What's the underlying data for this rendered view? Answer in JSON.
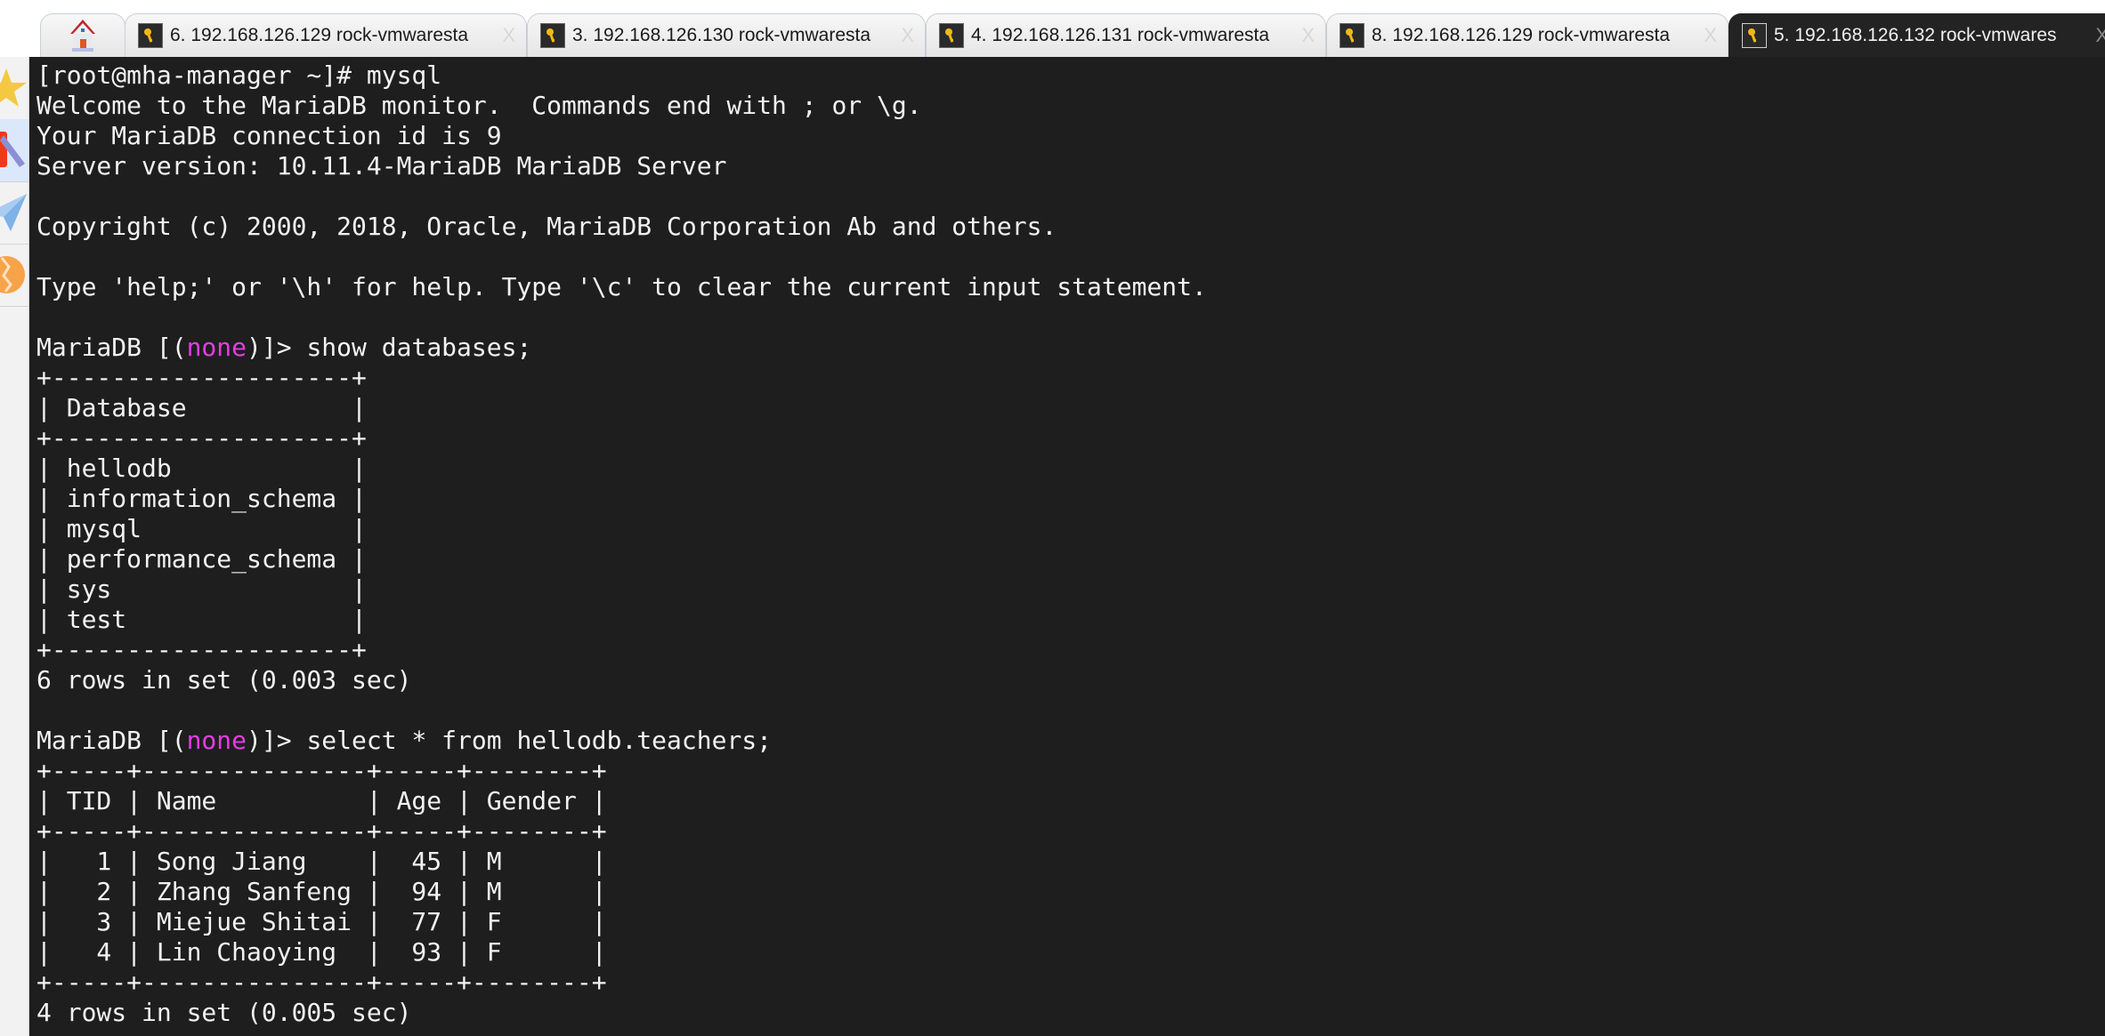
{
  "tabs": [
    {
      "icon": "home-icon",
      "label": ""
    },
    {
      "icon": "key-icon",
      "label": "6. 192.168.126.129 rock-vmwaresta",
      "active": false
    },
    {
      "icon": "key-icon",
      "label": "3. 192.168.126.130 rock-vmwaresta",
      "active": false
    },
    {
      "icon": "key-icon",
      "label": "4. 192.168.126.131 rock-vmwaresta",
      "active": false
    },
    {
      "icon": "key-icon",
      "label": "8. 192.168.126.129 rock-vmwaresta",
      "active": false
    },
    {
      "icon": "key-icon",
      "label": "5. 192.168.126.132 rock-vmwares",
      "active": true
    }
  ],
  "tab_close_glyph": "X",
  "sidebar": {
    "items": [
      {
        "icon": "star-icon"
      },
      {
        "icon": "bookmark-tool-icon"
      },
      {
        "icon": "paper-plane-icon"
      },
      {
        "icon": "globe-icon"
      }
    ]
  },
  "colors": {
    "terminal_bg": "#1e1e1e",
    "terminal_fg": "#f2f2f2",
    "highlight": "#e23ee2",
    "active_tab": "#232323"
  },
  "terminal": {
    "lines": [
      {
        "text": "[root@mha-manager ~]# mysql"
      },
      {
        "text": "Welcome to the MariaDB monitor.  Commands end with ; or \\g."
      },
      {
        "text": "Your MariaDB connection id is 9"
      },
      {
        "text": "Server version: 10.11.4-MariaDB MariaDB Server"
      },
      {
        "text": ""
      },
      {
        "text": "Copyright (c) 2000, 2018, Oracle, MariaDB Corporation Ab and others."
      },
      {
        "text": ""
      },
      {
        "text": "Type 'help;' or '\\h' for help. Type '\\c' to clear the current input statement."
      },
      {
        "text": ""
      },
      {
        "prompt_pre": "MariaDB [(",
        "prompt_db": "none",
        "prompt_post": ")]> ",
        "command": "show databases;"
      },
      {
        "text": "+--------------------+"
      },
      {
        "text": "| Database           |"
      },
      {
        "text": "+--------------------+"
      },
      {
        "text": "| hellodb            |"
      },
      {
        "text": "| information_schema |"
      },
      {
        "text": "| mysql              |"
      },
      {
        "text": "| performance_schema |"
      },
      {
        "text": "| sys                |"
      },
      {
        "text": "| test               |"
      },
      {
        "text": "+--------------------+"
      },
      {
        "text": "6 rows in set (0.003 sec)"
      },
      {
        "text": ""
      },
      {
        "prompt_pre": "MariaDB [(",
        "prompt_db": "none",
        "prompt_post": ")]> ",
        "command": "select * from hellodb.teachers;"
      },
      {
        "text": "+-----+---------------+-----+--------+"
      },
      {
        "text": "| TID | Name          | Age | Gender |"
      },
      {
        "text": "+-----+---------------+-----+--------+"
      },
      {
        "text": "|   1 | Song Jiang    |  45 | M      |"
      },
      {
        "text": "|   2 | Zhang Sanfeng |  94 | M      |"
      },
      {
        "text": "|   3 | Miejue Shitai |  77 | F      |"
      },
      {
        "text": "|   4 | Lin Chaoying  |  93 | F      |"
      },
      {
        "text": "+-----+---------------+-----+--------+"
      },
      {
        "text": "4 rows in set (0.005 sec)"
      }
    ]
  },
  "query_results": {
    "databases": {
      "columns": [
        "Database"
      ],
      "rows": [
        [
          "hellodb"
        ],
        [
          "information_schema"
        ],
        [
          "mysql"
        ],
        [
          "performance_schema"
        ],
        [
          "sys"
        ],
        [
          "test"
        ]
      ],
      "summary": "6 rows in set (0.003 sec)"
    },
    "teachers": {
      "columns": [
        "TID",
        "Name",
        "Age",
        "Gender"
      ],
      "rows": [
        [
          "1",
          "Song Jiang",
          "45",
          "M"
        ],
        [
          "2",
          "Zhang Sanfeng",
          "94",
          "M"
        ],
        [
          "3",
          "Miejue Shitai",
          "77",
          "F"
        ],
        [
          "4",
          "Lin Chaoying",
          "93",
          "F"
        ]
      ],
      "summary": "4 rows in set (0.005 sec)"
    }
  }
}
